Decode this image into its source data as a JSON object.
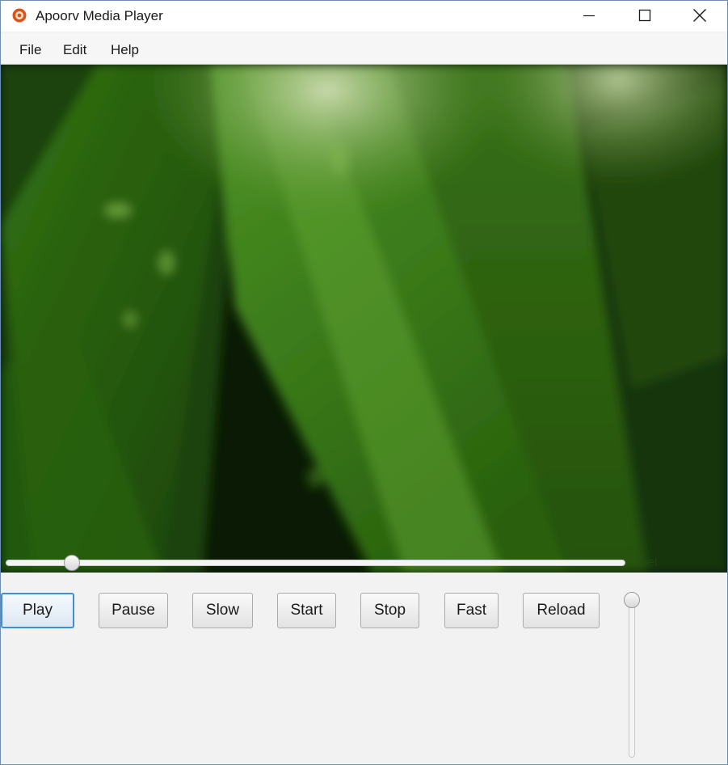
{
  "window": {
    "title": "Apoorv Media Player",
    "accent_color": "#3f8fd2",
    "app_icon": "media-player-icon"
  },
  "menubar": {
    "items": [
      {
        "label": "File"
      },
      {
        "label": "Edit"
      },
      {
        "label": "Help"
      }
    ]
  },
  "video": {
    "overlay_label": "abel",
    "description_icon": "video-frame"
  },
  "seek_slider": {
    "position_fraction": 0.11
  },
  "controls": {
    "buttons": [
      {
        "label": "Play"
      },
      {
        "label": "Pause"
      },
      {
        "label": "Slow"
      },
      {
        "label": "Start"
      },
      {
        "label": "Stop"
      },
      {
        "label": "Fast"
      },
      {
        "label": "Reload"
      }
    ]
  },
  "volume_slider": {
    "level_fraction": 1.0
  }
}
